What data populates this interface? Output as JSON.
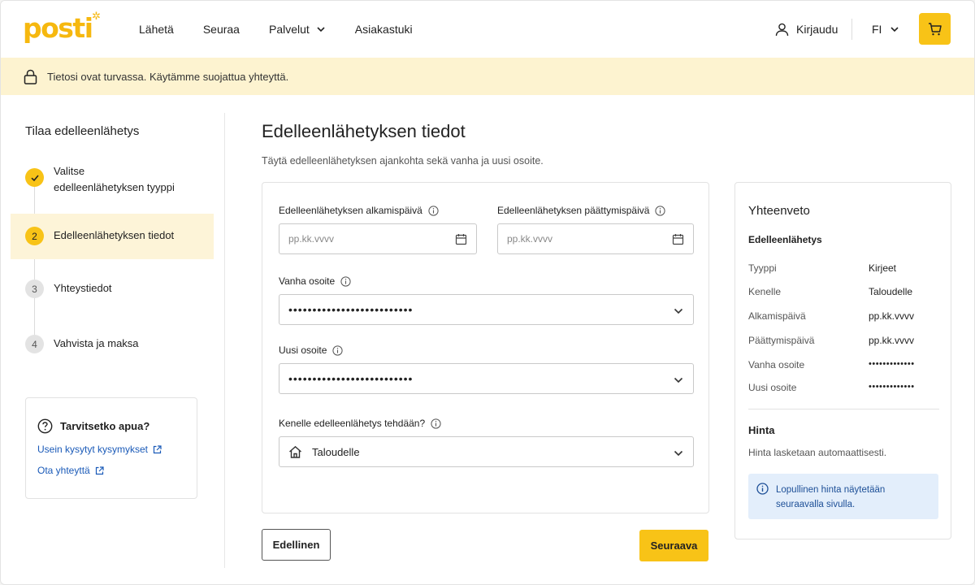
{
  "header": {
    "logo_text": "posti",
    "nav": [
      {
        "label": "Lähetä"
      },
      {
        "label": "Seuraa"
      },
      {
        "label": "Palvelut"
      },
      {
        "label": "Asiakastuki"
      }
    ],
    "login_label": "Kirjaudu",
    "language": "FI"
  },
  "banner": {
    "text": "Tietosi ovat turvassa. Käytämme suojattua yhteyttä."
  },
  "sidebar": {
    "title": "Tilaa edelleenlähetys",
    "steps": [
      {
        "number": "",
        "label": "Valitse edelleenlähetyksen tyyppi",
        "state": "done"
      },
      {
        "number": "2",
        "label": "Edelleenlähetyksen tiedot",
        "state": "active"
      },
      {
        "number": "3",
        "label": "Yhteystiedot",
        "state": "pending"
      },
      {
        "number": "4",
        "label": "Vahvista ja maksa",
        "state": "pending"
      }
    ],
    "help": {
      "title": "Tarvitsetko apua?",
      "links": [
        {
          "label": "Usein kysytyt kysymykset"
        },
        {
          "label": "Ota yhteyttä"
        }
      ]
    }
  },
  "main": {
    "title": "Edelleenlähetyksen tiedot",
    "description": "Täytä edelleenlähetyksen ajankohta sekä vanha ja uusi osoite.",
    "form": {
      "start_date": {
        "label": "Edelleenlähetyksen alkamispäivä",
        "placeholder": "pp.kk.vvvv"
      },
      "end_date": {
        "label": "Edelleenlähetyksen päättymispäivä",
        "placeholder": "pp.kk.vvvv"
      },
      "old_address": {
        "label": "Vanha osoite",
        "value": "••••••••••••••••••••••••••"
      },
      "new_address": {
        "label": "Uusi osoite",
        "value": "••••••••••••••••••••••••••"
      },
      "recipient": {
        "label": "Kenelle edelleenlähetys tehdään?",
        "value": "Taloudelle"
      }
    },
    "buttons": {
      "prev": "Edellinen",
      "next": "Seuraava"
    }
  },
  "summary": {
    "title": "Yhteenveto",
    "subtitle": "Edelleenlähetys",
    "rows": [
      {
        "key": "Tyyppi",
        "value": "Kirjeet"
      },
      {
        "key": "Kenelle",
        "value": "Taloudelle"
      },
      {
        "key": "Alkamispäivä",
        "value": "pp.kk.vvvv"
      },
      {
        "key": "Päättymispäivä",
        "value": "pp.kk.vvvv"
      },
      {
        "key": "Vanha osoite",
        "value": "•••••••••••••"
      },
      {
        "key": "Uusi osoite",
        "value": "•••••••••••••"
      }
    ],
    "price_title": "Hinta",
    "price_desc": "Hinta lasketaan automaattisesti.",
    "info": "Lopullinen hinta näytetään seuraavalla sivulla."
  },
  "colors": {
    "brand_yellow": "#f8c317",
    "banner_bg": "#fdf3d0",
    "link_blue": "#1a5ab8",
    "info_bg": "#e3eefb"
  }
}
